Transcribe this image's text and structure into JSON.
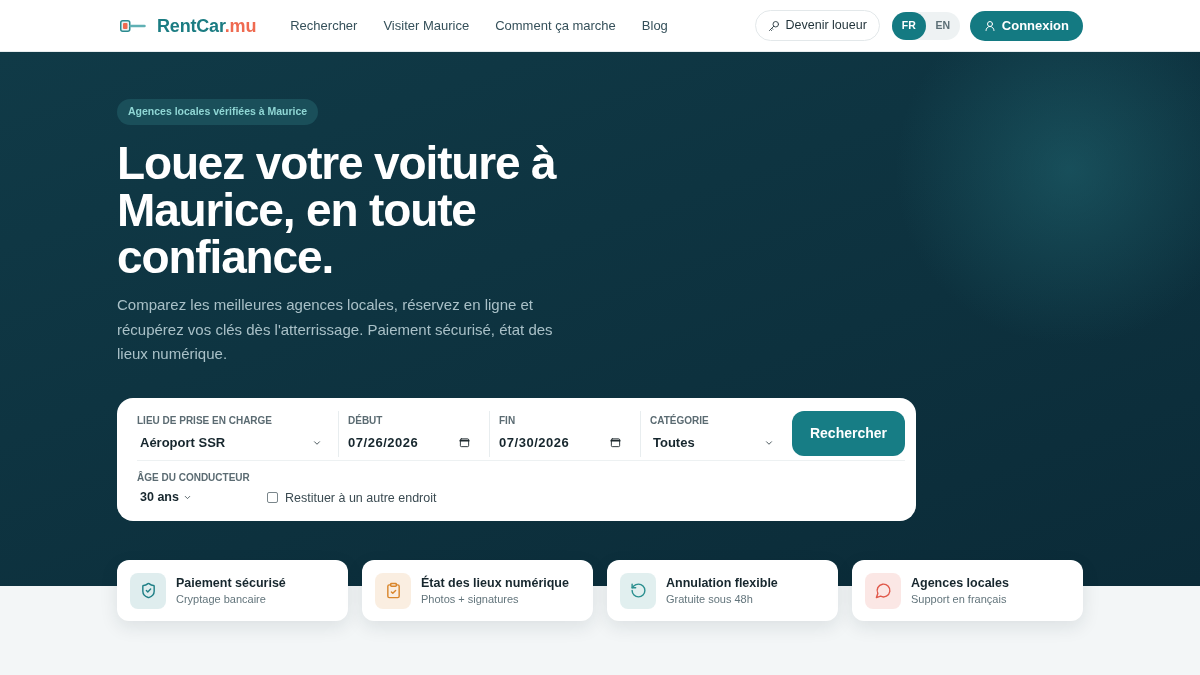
{
  "header": {
    "brand": {
      "name": "RentCar",
      "suffix": ".mu"
    },
    "nav": [
      "Rechercher",
      "Visiter Maurice",
      "Comment ça marche",
      "Blog"
    ],
    "become_host_button": "Devenir loueur",
    "languages": [
      {
        "label": "FR",
        "selected": true
      },
      {
        "label": "EN",
        "selected": false
      }
    ],
    "login_button": "Connexion"
  },
  "hero": {
    "badge": "Agences locales vérifiées à Maurice",
    "title": "Louez votre voiture à Maurice, en toute confiance.",
    "subtitle": "Comparez les meilleures agences locales, réservez en ligne et récupérez vos clés dès l'atterrissage. Paiement sécurisé, état des lieux numérique."
  },
  "search": {
    "fields": [
      {
        "kind": "select",
        "label": "LIEU DE PRISE EN CHARGE",
        "value": "Aéroport SSR"
      },
      {
        "kind": "date",
        "label": "DÉBUT",
        "value": "07/26/2026"
      },
      {
        "kind": "date",
        "label": "FIN",
        "value": "07/30/2026"
      },
      {
        "kind": "select",
        "label": "CATÉGORIE",
        "value": "Toutes"
      }
    ],
    "submit_button": "Rechercher",
    "driver_age": {
      "label": "ÂGE DU CONDUCTEUR",
      "value": "30 ans"
    },
    "return_elsewhere": {
      "label": "Restituer à un autre endroit",
      "checked": false
    }
  },
  "features": [
    {
      "kind": "shield",
      "title": "Paiement sécurisé",
      "subtitle": "Cryptage bancaire",
      "color": "#1f7f86"
    },
    {
      "kind": "clipboard",
      "title": "État des lieux numérique",
      "subtitle": "Photos + signatures",
      "color": "#d9862b"
    },
    {
      "kind": "refresh",
      "title": "Annulation flexible",
      "subtitle": "Gratuite sous 48h",
      "color": "#2a8f8f"
    },
    {
      "kind": "chat",
      "title": "Agences locales",
      "subtitle": "Support en français",
      "color": "#e0584a"
    }
  ]
}
